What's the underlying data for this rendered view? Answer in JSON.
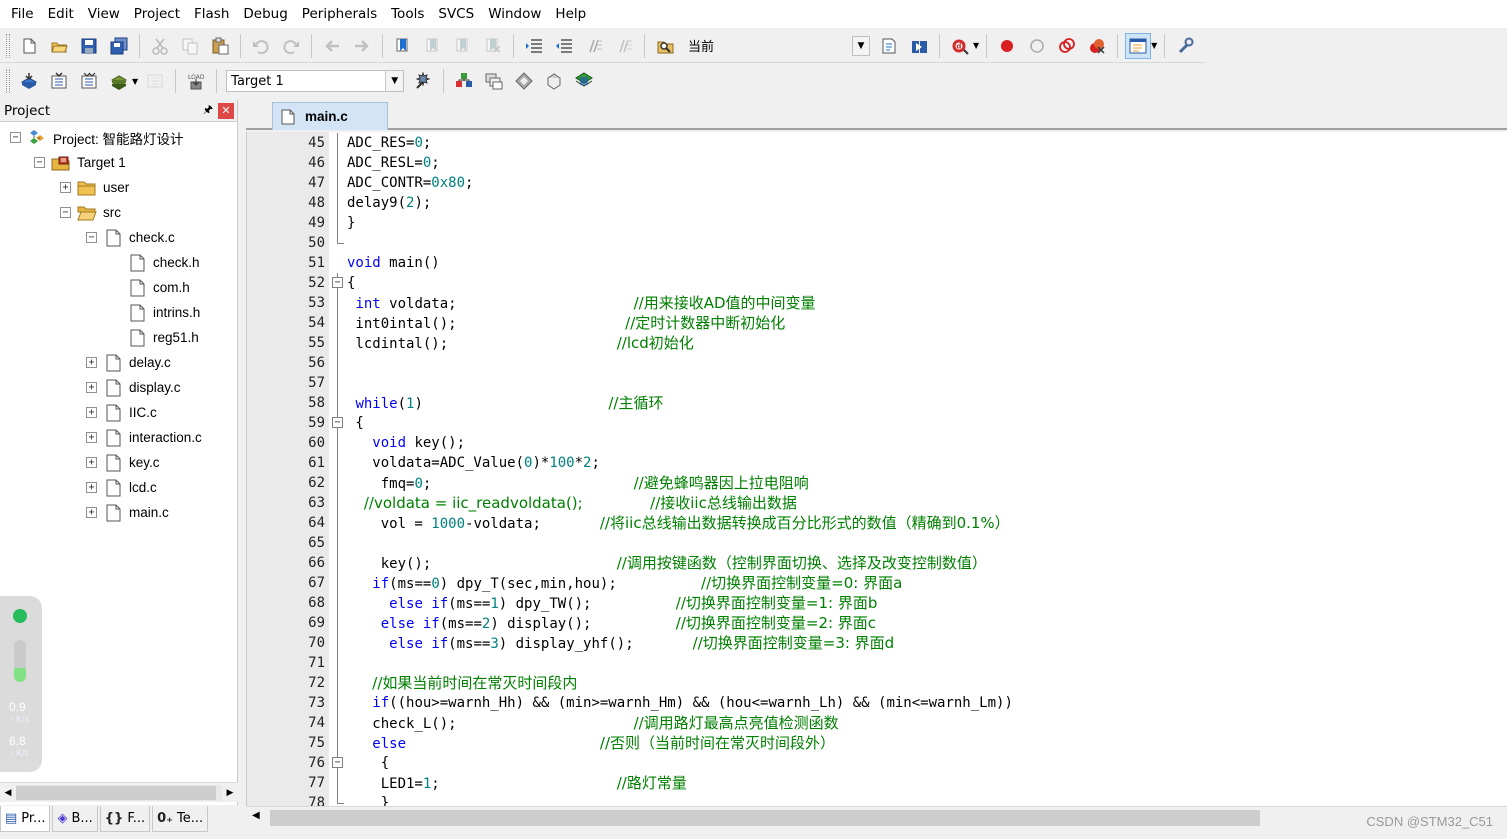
{
  "menu": [
    "File",
    "Edit",
    "View",
    "Project",
    "Flash",
    "Debug",
    "Peripherals",
    "Tools",
    "SVCS",
    "Window",
    "Help"
  ],
  "toolbar1": {
    "find_combo_value": "当前",
    "icons": [
      "new-file-icon",
      "open-file-icon",
      "save-icon",
      "save-all-icon",
      "cut-icon",
      "copy-icon",
      "paste-icon",
      "undo-icon",
      "redo-icon",
      "navigate-back-icon",
      "navigate-forward-icon",
      "insert-bookmark-icon",
      "previous-bookmark-icon",
      "next-bookmark-icon",
      "clear-bookmarks-icon",
      "indent-icon",
      "unindent-icon",
      "comment-icon",
      "uncomment-icon",
      "find-in-files-icon",
      "incremental-find-icon",
      "find-icon",
      "debug-session-icon",
      "insert-breakpoint-icon",
      "enable-breakpoint-icon",
      "disable-breakpoints-icon",
      "kill-breakpoints-icon",
      "window-layout-icon",
      "configure-icon"
    ]
  },
  "toolbar2": {
    "target_combo_value": "Target 1",
    "icons": [
      "translate-icon",
      "build-icon",
      "rebuild-icon",
      "batch-build-icon",
      "stop-build-icon",
      "download-icon",
      "target-options-icon",
      "manage-components-icon",
      "file-extensions-icon",
      "select-packs-icon",
      "pack-installer-icon",
      "run-time-environment-icon"
    ]
  },
  "project_panel": {
    "title": "Project",
    "tree": [
      {
        "label": "Project: 智能路灯设计",
        "indent": 0,
        "exp": "-",
        "icon": "project"
      },
      {
        "label": "Target 1",
        "indent": 1,
        "exp": "-",
        "icon": "target"
      },
      {
        "label": "user",
        "indent": 2,
        "exp": "+",
        "icon": "folder"
      },
      {
        "label": "src",
        "indent": 2,
        "exp": "-",
        "icon": "folder-open"
      },
      {
        "label": "check.c",
        "indent": 3,
        "exp": "-",
        "icon": "file"
      },
      {
        "label": "check.h",
        "indent": 4,
        "exp": "",
        "icon": "file"
      },
      {
        "label": "com.h",
        "indent": 4,
        "exp": "",
        "icon": "file"
      },
      {
        "label": "intrins.h",
        "indent": 4,
        "exp": "",
        "icon": "file"
      },
      {
        "label": "reg51.h",
        "indent": 4,
        "exp": "",
        "icon": "file"
      },
      {
        "label": "delay.c",
        "indent": 3,
        "exp": "+",
        "icon": "file"
      },
      {
        "label": "display.c",
        "indent": 3,
        "exp": "+",
        "icon": "file"
      },
      {
        "label": "IIC.c",
        "indent": 3,
        "exp": "+",
        "icon": "file"
      },
      {
        "label": "interaction.c",
        "indent": 3,
        "exp": "+",
        "icon": "file"
      },
      {
        "label": "key.c",
        "indent": 3,
        "exp": "+",
        "icon": "file"
      },
      {
        "label": "lcd.c",
        "indent": 3,
        "exp": "+",
        "icon": "file"
      },
      {
        "label": "main.c",
        "indent": 3,
        "exp": "+",
        "icon": "file"
      }
    ]
  },
  "speed_widget": {
    "up_value": "0.9",
    "up_unit": "K/s",
    "down_value": "6.8",
    "down_unit": "K/s",
    "level_percent": 33
  },
  "bottom_tabs": [
    {
      "label": "Pr...",
      "icon": "project-tab-icon",
      "glyph": "▤"
    },
    {
      "label": "B...",
      "icon": "books-tab-icon",
      "glyph": "◈"
    },
    {
      "label": "F...",
      "icon": "functions-tab-icon",
      "glyph": "{}"
    },
    {
      "label": "Te...",
      "icon": "templates-tab-icon",
      "glyph": "0₊"
    }
  ],
  "editor": {
    "tab_label": "main.c",
    "lines": [
      {
        "n": "45",
        "fold": "line",
        "t": [
          [
            "ADC_RES=",
            ""
          ],
          [
            "0",
            "nm"
          ],
          [
            ";",
            ""
          ]
        ]
      },
      {
        "n": "46",
        "fold": "line",
        "t": [
          [
            "ADC_RESL=",
            ""
          ],
          [
            "0",
            "nm"
          ],
          [
            ";",
            ""
          ]
        ]
      },
      {
        "n": "47",
        "fold": "line",
        "t": [
          [
            "ADC_CONTR=",
            ""
          ],
          [
            "0x80",
            "nm"
          ],
          [
            ";",
            ""
          ]
        ]
      },
      {
        "n": "48",
        "fold": "line",
        "t": [
          [
            "delay9(",
            ""
          ],
          [
            "2",
            "nm"
          ],
          [
            ");",
            ""
          ]
        ]
      },
      {
        "n": "49",
        "fold": "line",
        "t": [
          [
            "}",
            ""
          ]
        ]
      },
      {
        "n": "50",
        "fold": "end",
        "t": []
      },
      {
        "n": "51",
        "fold": "",
        "t": [
          [
            "void",
            "kw"
          ],
          [
            " main()",
            ""
          ]
        ]
      },
      {
        "n": "52",
        "fold": "box",
        "t": [
          [
            "{",
            ""
          ]
        ]
      },
      {
        "n": "53",
        "fold": "line",
        "t": [
          [
            " ",
            ""
          ],
          [
            "int",
            "kw"
          ],
          [
            " voldata;                     ",
            ""
          ],
          [
            "//用来接收AD值的中间变量",
            "cm"
          ]
        ]
      },
      {
        "n": "54",
        "fold": "line",
        "t": [
          [
            " int0intal();                    ",
            ""
          ],
          [
            "//定时计数器中断初始化",
            "cm"
          ]
        ]
      },
      {
        "n": "55",
        "fold": "line",
        "t": [
          [
            " lcdintal();                    ",
            ""
          ],
          [
            "//lcd初始化",
            "cm"
          ]
        ]
      },
      {
        "n": "56",
        "fold": "line",
        "t": []
      },
      {
        "n": "57",
        "fold": "line",
        "t": []
      },
      {
        "n": "58",
        "fold": "line",
        "t": [
          [
            " ",
            ""
          ],
          [
            "while",
            "kw"
          ],
          [
            "(",
            ""
          ],
          [
            "1",
            "nm"
          ],
          [
            ")                      ",
            ""
          ],
          [
            "//主循环",
            "cm"
          ]
        ]
      },
      {
        "n": "59",
        "fold": "box",
        "t": [
          [
            " {",
            ""
          ]
        ]
      },
      {
        "n": "60",
        "fold": "line",
        "t": [
          [
            "   ",
            ""
          ],
          [
            "void",
            "kw"
          ],
          [
            " key();",
            ""
          ]
        ]
      },
      {
        "n": "61",
        "fold": "line",
        "t": [
          [
            "   voldata=ADC_Value(",
            ""
          ],
          [
            "0",
            "nm"
          ],
          [
            ")*",
            ""
          ],
          [
            "100",
            "nm"
          ],
          [
            "*",
            ""
          ],
          [
            "2",
            "nm"
          ],
          [
            ";",
            ""
          ]
        ]
      },
      {
        "n": "62",
        "fold": "line",
        "t": [
          [
            "    fmq=",
            ""
          ],
          [
            "0",
            "nm"
          ],
          [
            ";                        ",
            ""
          ],
          [
            "//避免蜂鸣器因上拉电阻响",
            "cm"
          ]
        ]
      },
      {
        "n": "63",
        "fold": "line",
        "t": [
          [
            "  ",
            ""
          ],
          [
            "//voldata = iic_readvoldata();",
            "cm"
          ],
          [
            "        ",
            ""
          ],
          [
            "//接收iic总线输出数据",
            "cm"
          ]
        ]
      },
      {
        "n": "64",
        "fold": "line",
        "t": [
          [
            "    vol = ",
            ""
          ],
          [
            "1000",
            "nm"
          ],
          [
            "-voldata;       ",
            ""
          ],
          [
            "//将iic总线输出数据转换成百分比形式的数值（精确到0.1%）",
            "cm"
          ]
        ]
      },
      {
        "n": "65",
        "fold": "line",
        "t": []
      },
      {
        "n": "66",
        "fold": "line",
        "t": [
          [
            "    key();                      ",
            ""
          ],
          [
            "//调用按键函数（控制界面切换、选择及改变控制数值）",
            "cm"
          ]
        ]
      },
      {
        "n": "67",
        "fold": "line",
        "t": [
          [
            "   ",
            ""
          ],
          [
            "if",
            "kw"
          ],
          [
            "(ms==",
            ""
          ],
          [
            "0",
            "nm"
          ],
          [
            ") dpy_T(sec,min,hou);          ",
            ""
          ],
          [
            "//切换界面控制变量=0: 界面a",
            "cm"
          ]
        ]
      },
      {
        "n": "68",
        "fold": "line",
        "t": [
          [
            "     ",
            ""
          ],
          [
            "else",
            "kw"
          ],
          [
            " ",
            ""
          ],
          [
            "if",
            "kw"
          ],
          [
            "(ms==",
            ""
          ],
          [
            "1",
            "nm"
          ],
          [
            ") dpy_TW();          ",
            ""
          ],
          [
            "//切换界面控制变量=1: 界面b",
            "cm"
          ]
        ]
      },
      {
        "n": "69",
        "fold": "line",
        "t": [
          [
            "    ",
            ""
          ],
          [
            "else",
            "kw"
          ],
          [
            " ",
            ""
          ],
          [
            "if",
            "kw"
          ],
          [
            "(ms==",
            ""
          ],
          [
            "2",
            "nm"
          ],
          [
            ") display();          ",
            ""
          ],
          [
            "//切换界面控制变量=2: 界面c",
            "cm"
          ]
        ]
      },
      {
        "n": "70",
        "fold": "line",
        "t": [
          [
            "     ",
            ""
          ],
          [
            "else",
            "kw"
          ],
          [
            " ",
            ""
          ],
          [
            "if",
            "kw"
          ],
          [
            "(ms==",
            ""
          ],
          [
            "3",
            "nm"
          ],
          [
            ") display_yhf();       ",
            ""
          ],
          [
            "//切换界面控制变量=3: 界面d",
            "cm"
          ]
        ]
      },
      {
        "n": "71",
        "fold": "line",
        "t": []
      },
      {
        "n": "72",
        "fold": "line",
        "t": [
          [
            "   ",
            ""
          ],
          [
            "//如果当前时间在常灭时间段内",
            "cm"
          ]
        ]
      },
      {
        "n": "73",
        "fold": "line",
        "t": [
          [
            "   ",
            ""
          ],
          [
            "if",
            "kw"
          ],
          [
            "((hou>=warnh_Hh) && (min>=warnh_Hm) && (hou<=warnh_Lh) && (min<=warnh_Lm))",
            ""
          ]
        ]
      },
      {
        "n": "74",
        "fold": "line",
        "t": [
          [
            "   check_L();                     ",
            ""
          ],
          [
            "//调用路灯最高点亮值检测函数",
            "cm"
          ]
        ]
      },
      {
        "n": "75",
        "fold": "line",
        "t": [
          [
            "   ",
            ""
          ],
          [
            "else",
            "kw"
          ],
          [
            "                       ",
            ""
          ],
          [
            "//否则（当前时间在常灭时间段外）",
            "cm"
          ]
        ]
      },
      {
        "n": "76",
        "fold": "box",
        "t": [
          [
            "    {",
            ""
          ]
        ]
      },
      {
        "n": "77",
        "fold": "line",
        "t": [
          [
            "    LED1=",
            ""
          ],
          [
            "1",
            "nm"
          ],
          [
            ";                     ",
            ""
          ],
          [
            "//路灯常量",
            "cm"
          ]
        ]
      },
      {
        "n": "78",
        "fold": "end",
        "t": [
          [
            "    }",
            ""
          ]
        ]
      }
    ]
  },
  "watermark": "CSDN @STM32_C51"
}
